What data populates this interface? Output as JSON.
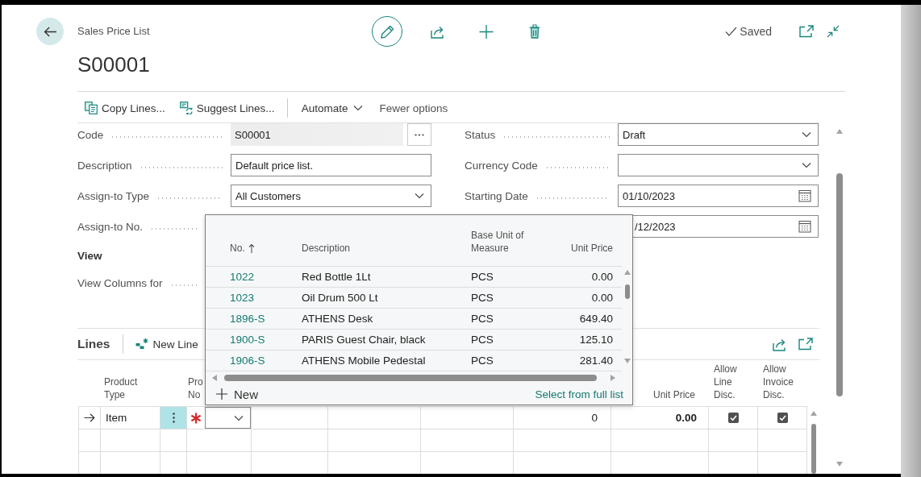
{
  "page": {
    "caption": "Sales Price List",
    "title": "S00001",
    "save_status": "Saved"
  },
  "actions": [
    {
      "kind": "command",
      "label": "Copy Lines..."
    },
    {
      "kind": "command",
      "label": "Suggest Lines..."
    },
    {
      "kind": "menu",
      "label": "Automate"
    },
    {
      "kind": "toggle",
      "label": "Fewer options"
    }
  ],
  "general": {
    "left": [
      {
        "label": "Code",
        "kind": "readonly",
        "value": "S00001"
      },
      {
        "label": "Description",
        "kind": "text",
        "value": "Default price list."
      },
      {
        "label": "Assign-to Type",
        "kind": "select",
        "value": "All Customers"
      },
      {
        "label": "Assign-to No.",
        "kind": "covered"
      }
    ],
    "right": [
      {
        "label": "Status",
        "kind": "select",
        "value": "Draft"
      },
      {
        "label": "Currency Code",
        "kind": "select"
      },
      {
        "label": "Starting Date",
        "kind": "date",
        "value": "01/10/2023"
      },
      {
        "kind": "date",
        "value": "/12/2023"
      }
    ],
    "view": {
      "heading": "View",
      "fields": [
        {
          "label": "View Columns for",
          "kind": "covered"
        }
      ]
    }
  },
  "lookup": {
    "columns": [
      {
        "label": "No.",
        "sorted": true
      },
      {
        "label": "Description",
        "sorted": false
      },
      {
        "label": "Base Unit of Measure",
        "sorted": false
      },
      {
        "label": "Unit Price",
        "sorted": false
      }
    ],
    "rows": [
      {
        "no": "1022",
        "description": "Red Bottle 1Lt",
        "unit": "PCS",
        "price": "0.00"
      },
      {
        "no": "1023",
        "description": "Oil Drum 500 Lt",
        "unit": "PCS",
        "price": "0.00"
      },
      {
        "no": "1896-S",
        "description": "ATHENS Desk",
        "unit": "PCS",
        "price": "649.40"
      },
      {
        "no": "1900-S",
        "description": "PARIS Guest Chair, black",
        "unit": "PCS",
        "price": "125.10"
      },
      {
        "no": "1906-S",
        "description": "ATHENS Mobile Pedestal",
        "unit": "PCS",
        "price": "281.40"
      }
    ],
    "new": "New",
    "full_list": "Select from full list"
  },
  "lines": {
    "title": "Lines",
    "new_line": "New Line",
    "columns": {
      "product_type": "Product Type",
      "product_no": "Pro No",
      "unit_price": "Unit Price",
      "allow_line_disc": "Allow Line Disc.",
      "allow_invoice_disc": "Allow Invoice Disc."
    },
    "rows": [
      {
        "current": true,
        "product_type": "Item",
        "required": true,
        "column_8": "0",
        "unit_price": "0.00",
        "allow_line_disc": true,
        "allow_invoice_disc": true
      },
      {
        "current": false
      },
      {
        "current": false
      }
    ]
  }
}
